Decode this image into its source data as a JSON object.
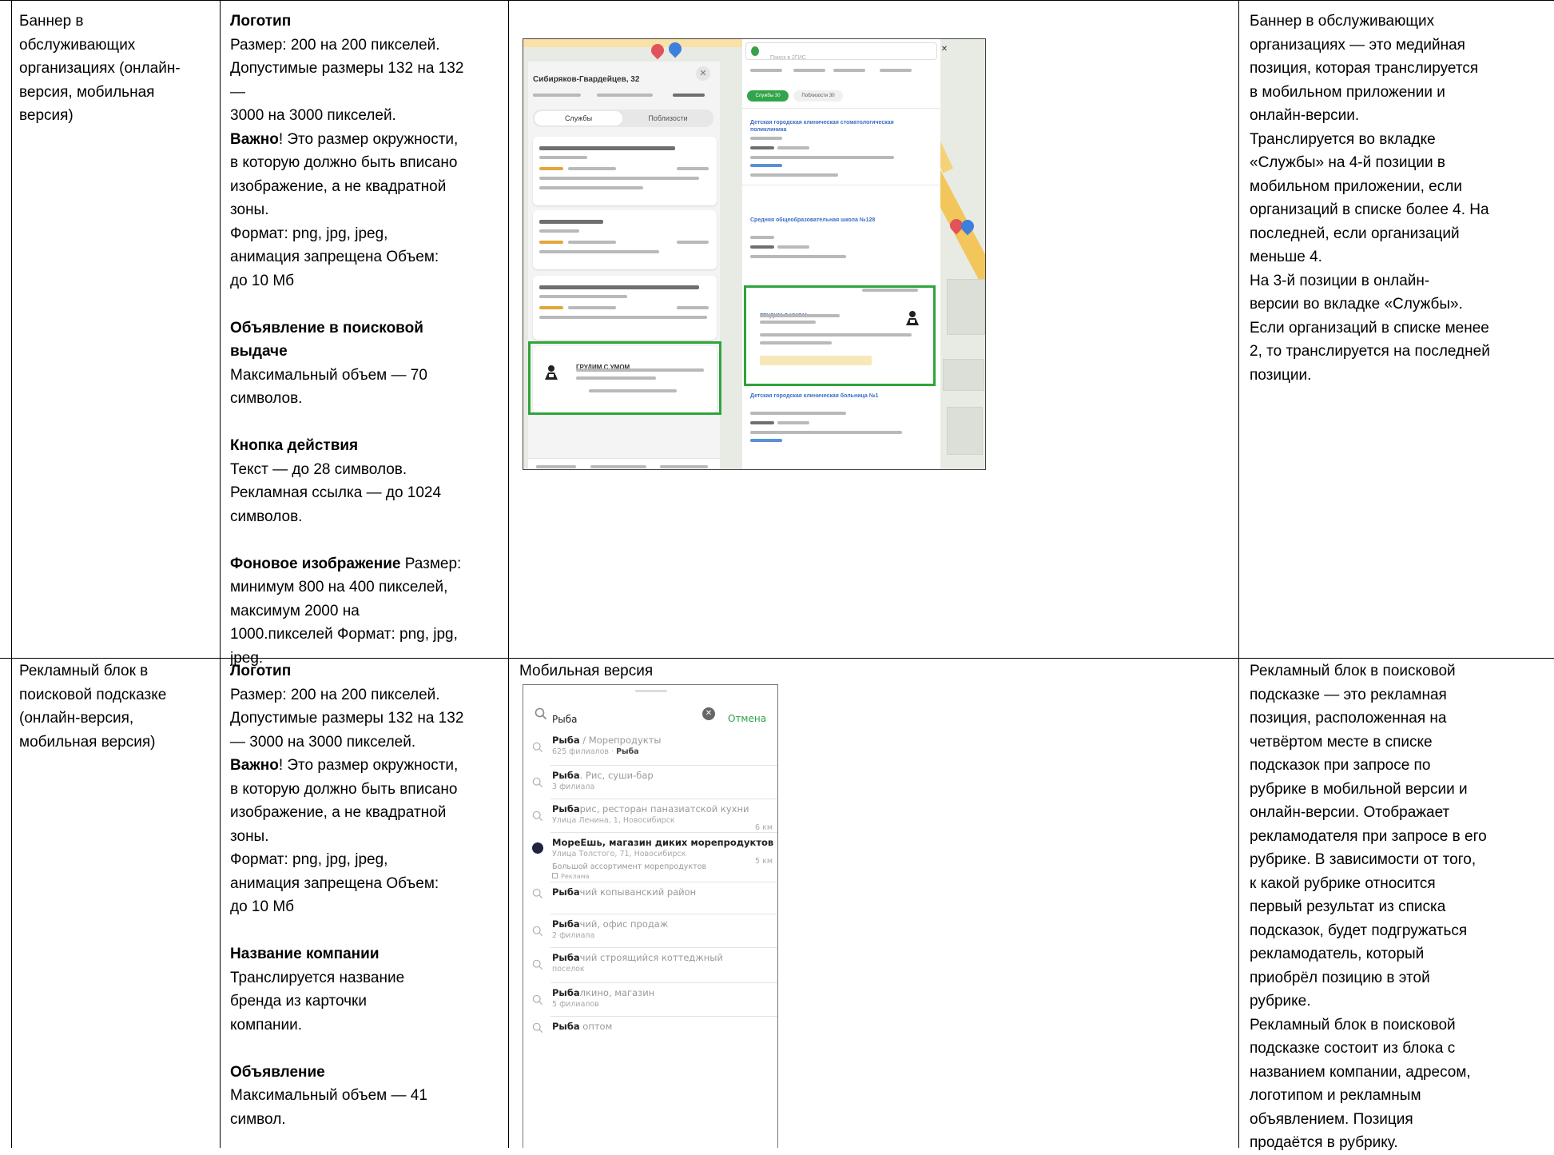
{
  "table": {
    "row1": {
      "name": [
        "Баннер в",
        "обслуживающих",
        "организациях (онлайн-",
        "версия,  мобильная",
        "версия)"
      ],
      "requirements": [
        {
          "bold": "Логотип",
          "normal": ""
        },
        {
          "bold": "",
          "normal": "Размер: 200 на 200 пикселей."
        },
        {
          "bold": "",
          "normal": "Допустимые размеры 132 на 132"
        },
        {
          "bold": "",
          "normal": "—"
        },
        {
          "bold": "",
          "normal": "3000 на 3000 пикселей."
        },
        {
          "bold": "Важно",
          "normal": "! Это размер окружности,"
        },
        {
          "bold": "",
          "normal": "в которую должно быть вписано"
        },
        {
          "bold": "",
          "normal": "изображение, а не квадратной"
        },
        {
          "bold": "",
          "normal": "зоны."
        },
        {
          "bold": "",
          "normal": "Формат: png, jpg, jpeg,"
        },
        {
          "bold": "",
          "normal": "анимация запрещена Объем:"
        },
        {
          "bold": "",
          "normal": "до 10 Мб"
        },
        {
          "bold": "",
          "normal": ""
        },
        {
          "bold": "Объявление в поисковой",
          "normal": ""
        },
        {
          "bold": "выдаче",
          "normal": ""
        },
        {
          "bold": "",
          "normal": "Максимальный объем — 70"
        },
        {
          "bold": "",
          "normal": "символов."
        },
        {
          "bold": "",
          "normal": ""
        },
        {
          "bold": "Кнопка действия",
          "normal": ""
        },
        {
          "bold": "",
          "normal": "Текст — до 28 символов."
        },
        {
          "bold": "",
          "normal": "Рекламная ссылка — до 1024"
        },
        {
          "bold": "",
          "normal": "символов."
        },
        {
          "bold": "",
          "normal": ""
        },
        {
          "bold": "Фоновое изображение",
          "normal": " Размер:"
        },
        {
          "bold": "",
          "normal": "минимум 800 на 400 пикселей,"
        },
        {
          "bold": "",
          "normal": "максимум 2000 на"
        },
        {
          "bold": "",
          "normal": "1000.пикселей Формат: png, jpg,"
        },
        {
          "bold": "",
          "normal": "jpeg."
        }
      ],
      "description": [
        "Баннер в обслуживающих",
        "организациях — это медийная",
        "позиция, которая транслируется",
        "в мобильном приложении и",
        "онлайн-версии.",
        "Транслируется во вкладке",
        "«Службы» на 4-й позиции в",
        "мобильном приложении, если",
        "организаций в списке более 4. На",
        "последней, если организаций",
        "меньше 4.",
        "На 3-й позиции в онлайн-",
        "версии во вкладке «Службы».",
        "Если организаций в списке менее",
        "2, то транслируется на последней",
        "позиции."
      ]
    },
    "row2": {
      "name": [
        "Рекламный блок в",
        "поисковой подсказке",
        "(онлайн-версия,",
        "мобильная версия)"
      ],
      "example_caption": "Мобильная версия",
      "requirements": [
        {
          "bold": "Логотип",
          "normal": ""
        },
        {
          "bold": "",
          "normal": "Размер: 200 на 200 пикселей."
        },
        {
          "bold": "",
          "normal": "Допустимые размеры 132 на 132"
        },
        {
          "bold": "",
          "normal": "— 3000 на 3000 пикселей."
        },
        {
          "bold": "Важно",
          "normal": "! Это размер окружности,"
        },
        {
          "bold": "",
          "normal": "в которую должно быть вписано"
        },
        {
          "bold": "",
          "normal": "изображение, а не квадратной"
        },
        {
          "bold": "",
          "normal": "зоны."
        },
        {
          "bold": "",
          "normal": "Формат: png, jpg, jpeg,"
        },
        {
          "bold": "",
          "normal": "анимация запрещена Объем:"
        },
        {
          "bold": "",
          "normal": "до 10 Мб"
        },
        {
          "bold": "",
          "normal": ""
        },
        {
          "bold": "Название компании",
          "normal": ""
        },
        {
          "bold": "",
          "normal": "Транслируется название"
        },
        {
          "bold": "",
          "normal": "бренда из карточки"
        },
        {
          "bold": "",
          "normal": "компании."
        },
        {
          "bold": "",
          "normal": ""
        },
        {
          "bold": "Объявление",
          "normal": ""
        },
        {
          "bold": "",
          "normal": "Максимальный объем — 41"
        },
        {
          "bold": "",
          "normal": "символ."
        }
      ],
      "description": [
        "Рекламный блок в поисковой",
        "подсказке — это рекламная",
        "позиция, расположенная на",
        "четвёртом месте в списке",
        "подсказок при запросе по",
        "рубрике в мобильной версии и",
        "онлайн-версии. Отображает",
        "рекламодателя при запросе в его",
        "рубрике.  В зависимости от того,",
        "к какой рубрике относится",
        "первый результат из списка",
        "подсказок, будет подгружаться",
        "рекламодатель, который",
        "приобрёл позицию в этой",
        "рубрике.",
        "Рекламный блок в поисковой",
        "подсказке состоит из блока с",
        "названием компании, адресом,",
        "логотипом и рекламным",
        "объявлением. Позиция",
        "продаётся в рубрику."
      ]
    }
  },
  "screenshot_left": {
    "header": "Сибиряков-Гвардейцев, 32",
    "tab_services": "Службы",
    "tab_nearby": "Поблизости",
    "ad_card_title": "ГРУДИМ С УМОМ"
  },
  "screenshot_right": {
    "search_placeholder": "Поиск в 2ГИС",
    "chip_services": "Службы 30",
    "chip_nearby": "Поблизости 30",
    "result_1": "Детская городская клиническая стоматологическая поликлиника",
    "result_2": "Средняя общеобразовательная школа №128",
    "ad_title": "ГРУДИМ С УМОМ",
    "result_3": "Детская городская клиническая больница №1"
  },
  "mobile_suggest": {
    "query": "Рыба",
    "cancel": "Отмена",
    "items": [
      {
        "bold": "Рыба",
        "rest": " / Морепродукты",
        "sub_pre": "625 филиалов · ",
        "sub_bold": "Рыба",
        "dist": ""
      },
      {
        "bold": "Рыба",
        "rest": ". Рис, суши-бар",
        "sub_pre": "3 филиала",
        "sub_bold": "",
        "dist": ""
      },
      {
        "bold": "Рыба",
        "rest": "рис, ресторан паназиатской кухни",
        "sub_pre": "Улица Ленина, 1, Новосибирск",
        "sub_bold": "",
        "dist": "6 км"
      },
      {
        "bold": "МореЕшь, магазин диких морепродуктов",
        "rest": "",
        "sub_pre": "Улица Толстого, 71, Новосибирск",
        "sub_bold": "",
        "dist": "5 км"
      },
      {
        "bold": "Рыба",
        "rest": "чий копыванский район",
        "sub_pre": "",
        "sub_bold": "",
        "dist": ""
      },
      {
        "bold": "Рыба",
        "rest": "чий, офис продаж",
        "sub_pre": "2 филиала",
        "sub_bold": "",
        "dist": ""
      },
      {
        "bold": "Рыба",
        "rest": "чий строящийся коттеджный",
        "sub_pre": "поселок",
        "sub_bold": "",
        "dist": ""
      },
      {
        "bold": "Рыба",
        "rest": "лкино, магазин",
        "sub_pre": "5 филиалов",
        "sub_bold": "",
        "dist": ""
      },
      {
        "bold": "Рыба",
        "rest": " оптом",
        "sub_pre": "",
        "sub_bold": "",
        "dist": ""
      }
    ],
    "ad_text": "Большой ассортимент морепродуктов",
    "ad_label": "Реклама"
  },
  "colors": {
    "green_frame": "#2fa43a",
    "link_blue": "#3a6fc4",
    "cancel_green": "#2ea043"
  }
}
